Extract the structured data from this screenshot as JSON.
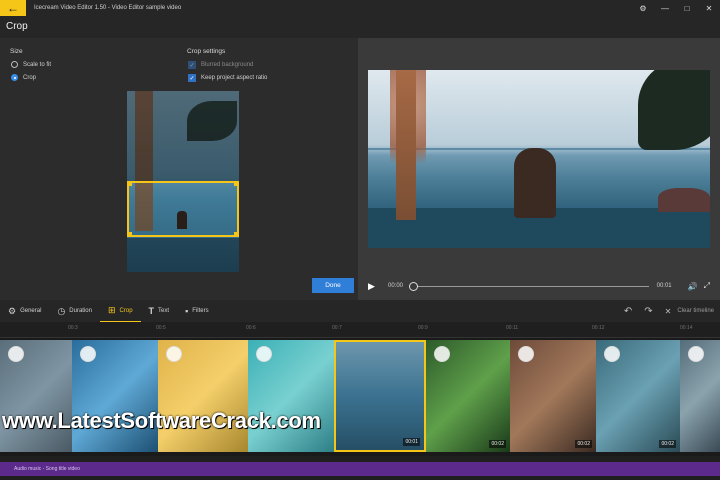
{
  "app": {
    "title": "Icecream Video Editor 1.50 - Video Editor sample video",
    "back_icon": "back-arrow-icon"
  },
  "header": {
    "title": "Crop"
  },
  "size": {
    "label": "Size",
    "options": [
      {
        "label": "Scale to fit",
        "selected": false
      },
      {
        "label": "Crop",
        "selected": true
      }
    ]
  },
  "crop_settings": {
    "label": "Crop settings",
    "options": [
      {
        "label": "Blurred background",
        "checked": true,
        "enabled": false
      },
      {
        "label": "Keep project aspect ratio",
        "checked": true,
        "enabled": true
      }
    ]
  },
  "done_button": "Done",
  "player": {
    "current_time": "00:00",
    "end_time": "00:01",
    "progress": 0
  },
  "tabs": [
    {
      "label": "General",
      "icon": "gear-icon",
      "active": false
    },
    {
      "label": "Duration",
      "icon": "clock-icon",
      "active": false
    },
    {
      "label": "Crop",
      "icon": "crop-icon",
      "active": true
    },
    {
      "label": "Text",
      "icon": "text-icon",
      "active": false
    },
    {
      "label": "Filters",
      "icon": "filters-icon",
      "active": false
    }
  ],
  "toolbar_right": {
    "clear_label": "Clear timeline"
  },
  "timeline": {
    "ruler_labels": [
      "00:3",
      "00:5",
      "00:6",
      "00:7",
      "00:9",
      "00:11",
      "00:12",
      "00:14"
    ],
    "clip_durations": [
      "",
      "",
      "",
      "",
      "00:01",
      "00:02",
      "00:02",
      "00:02",
      ""
    ],
    "audio_label": "Audio music - Song title video"
  },
  "watermark": "www.LatestSoftwareCrack.com",
  "colors": {
    "accent": "#f5c518",
    "primary": "#2f7ed8",
    "audio": "#5b2a8a"
  }
}
